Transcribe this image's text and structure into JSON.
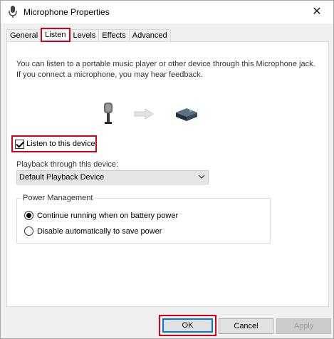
{
  "window": {
    "title": "Microphone Properties",
    "title_icon": "microphone-icon",
    "close_glyph": "✕"
  },
  "tabs": [
    {
      "label": "General",
      "active": false
    },
    {
      "label": "Listen",
      "active": true
    },
    {
      "label": "Levels",
      "active": false
    },
    {
      "label": "Effects",
      "active": false
    },
    {
      "label": "Advanced",
      "active": false
    }
  ],
  "listen": {
    "description": "You can listen to a portable music player or other device through this Microphone jack.  If you connect a microphone, you may hear feedback.",
    "icons": [
      "microphone-icon",
      "arrow-right-icon",
      "speaker-device-icon"
    ],
    "checkbox_label": "Listen to this device",
    "checkbox_checked": true,
    "playback_label": "Playback through this device:",
    "playback_value": "Default Playback Device"
  },
  "power": {
    "title": "Power Management",
    "options": [
      {
        "label": "Continue running when on battery power",
        "selected": true
      },
      {
        "label": "Disable automatically to save power",
        "selected": false
      }
    ]
  },
  "buttons": {
    "ok": "OK",
    "cancel": "Cancel",
    "apply": "Apply"
  },
  "colors": {
    "highlight": "#d0021b",
    "focus": "#0078d7"
  }
}
